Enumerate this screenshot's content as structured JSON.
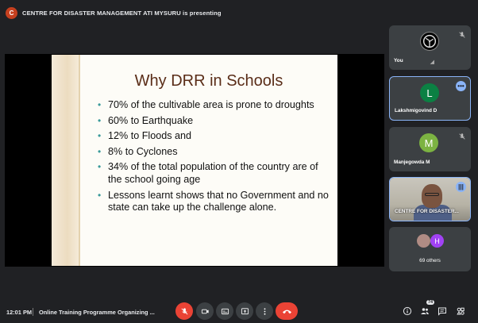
{
  "banner": {
    "initial": "C",
    "text": "CENTRE FOR DISASTER MANAGEMENT ATI MYSURU is presenting"
  },
  "slide": {
    "title": "Why DRR in Schools",
    "bullets": [
      "70% of the cultivable area is prone to droughts",
      "60% to Earthquake",
      "12% to Floods and",
      "8% to Cyclones",
      "34% of the total population of the country are of the school going age",
      "Lessons learnt shows that no Government and no state can take up the challenge alone."
    ]
  },
  "participants": {
    "you": {
      "name": "You"
    },
    "p1": {
      "initial": "L",
      "name": "Lakshmigovind D",
      "color": "#0b8043"
    },
    "p2": {
      "initial": "M",
      "name": "Manjegowda M",
      "color": "#7cb342"
    },
    "p3": {
      "name": "CENTRE FOR DISASTER..."
    },
    "others": {
      "initial": "H",
      "color": "#a142f4",
      "label": "69 others"
    }
  },
  "bottom_bar": {
    "time": "12:01 PM",
    "meeting_title": "Online Training Programme Organizing ...",
    "people_count": "74"
  },
  "icons": [
    "mic-off-icon",
    "camera-icon",
    "captions-icon",
    "present-icon",
    "more-icon",
    "hangup-icon",
    "info-icon",
    "people-icon",
    "chat-icon",
    "activities-icon"
  ]
}
